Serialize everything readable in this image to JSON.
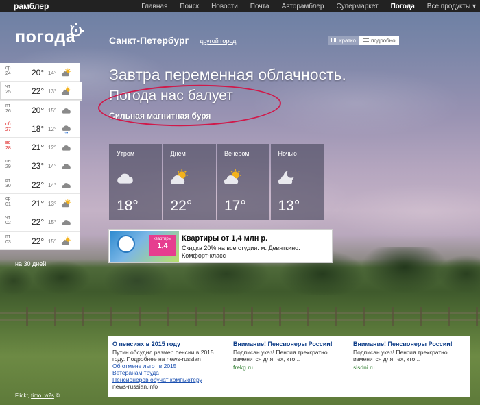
{
  "brand": "рамблер",
  "nav": [
    "Главная",
    "Поиск",
    "Новости",
    "Почта",
    "Авторамблер",
    "Супермаркет",
    "Погода",
    "Все продукты ▾"
  ],
  "nav_active": "Погода",
  "logo": "погода",
  "city": "Санкт-Петербург",
  "other_city": "другой город",
  "view": {
    "brief": "кратко",
    "detailed": "подробно",
    "selected": "подробно"
  },
  "headline": "Завтра переменная облачность.",
  "subheadline": "Погода нас балует",
  "storm": "Сильная магнитная буря",
  "days": [
    {
      "dow": "ср",
      "date": "24",
      "day_temp": "20°",
      "night_temp": "14°",
      "icon": "sun-cloud-icon",
      "weekend": false
    },
    {
      "dow": "чт",
      "date": "25",
      "day_temp": "22°",
      "night_temp": "13°",
      "icon": "sun-cloud-icon",
      "weekend": false,
      "selected": true
    },
    {
      "dow": "пт",
      "date": "26",
      "day_temp": "20°",
      "night_temp": "15°",
      "icon": "cloud-icon",
      "weekend": false
    },
    {
      "dow": "сб",
      "date": "27",
      "day_temp": "18°",
      "night_temp": "12°",
      "icon": "rain-cloud-icon",
      "weekend": true
    },
    {
      "dow": "вс",
      "date": "28",
      "day_temp": "21°",
      "night_temp": "12°",
      "icon": "cloud-icon",
      "weekend": true
    },
    {
      "dow": "пн",
      "date": "29",
      "day_temp": "23°",
      "night_temp": "14°",
      "icon": "cloud-icon",
      "weekend": false
    },
    {
      "dow": "вт",
      "date": "30",
      "day_temp": "22°",
      "night_temp": "14°",
      "icon": "cloud-icon",
      "weekend": false
    },
    {
      "dow": "ср",
      "date": "01",
      "day_temp": "21°",
      "night_temp": "13°",
      "icon": "sun-cloud-icon",
      "weekend": false
    },
    {
      "dow": "чт",
      "date": "02",
      "day_temp": "22°",
      "night_temp": "15°",
      "icon": "cloud-icon",
      "weekend": false
    },
    {
      "dow": "пт",
      "date": "03",
      "day_temp": "22°",
      "night_temp": "15°",
      "icon": "sun-cloud-icon",
      "weekend": false
    }
  ],
  "days_30_link": "на 30 дней",
  "parts": [
    {
      "label": "Утром",
      "temp": "18°",
      "icon": "cloud-icon"
    },
    {
      "label": "Днем",
      "temp": "22°",
      "icon": "sun-cloud-icon"
    },
    {
      "label": "Вечером",
      "temp": "17°",
      "icon": "sun-cloud-icon"
    },
    {
      "label": "Ночью",
      "temp": "13°",
      "icon": "moon-cloud-icon"
    }
  ],
  "ad": {
    "title": "Квартиры от 1,4 млн р.",
    "line1": "Скидка 20% на все студии. м. Девяткино.",
    "line2": "Комфорт-класс",
    "promo_top": "квартиры",
    "promo_price": "1,4"
  },
  "news": [
    {
      "title": "О пенсиях в 2015 году",
      "body": "Путин обсудил размер пенсии в 2015 году. Подробнее на news-russian",
      "links": [
        "Об отмене льгот в 2015",
        "Ветеранам труда",
        "Пенсионеров обучат компьютеру"
      ],
      "source": "news-russian.info"
    },
    {
      "title": "Внимание! Пенсионеры России!",
      "body": "Подписан указ! Пенсия трехкратно изменится для тех, кто...",
      "links": [],
      "source": "frekg.ru"
    },
    {
      "title": "Внимание! Пенсионеры России!",
      "body": "Подписан указ! Пенсия трехкратно изменится для тех, кто...",
      "links": [],
      "source": "slsdni.ru"
    }
  ],
  "credit": {
    "prefix": "Flickr, ",
    "author": "timo_w2s",
    "suffix": " ©"
  },
  "colors": {
    "oval": "#d0194a",
    "sun": "#f3b21b",
    "cloud": "#8a8a8a",
    "link": "#1a4fb0"
  }
}
